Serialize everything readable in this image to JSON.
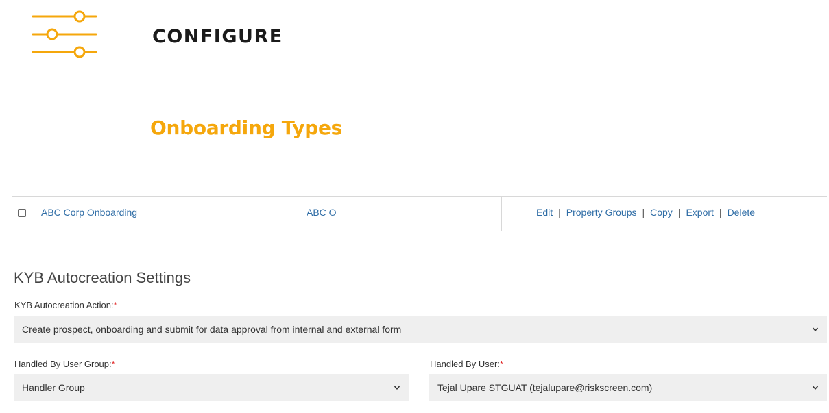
{
  "header": {
    "icon": "sliders-icon",
    "title": "CONFIGURE",
    "accent_color": "#f5a70c"
  },
  "page": {
    "heading": "Onboarding Types"
  },
  "table": {
    "rows": [
      {
        "name": "ABC Corp Onboarding",
        "code": "ABC O",
        "actions": {
          "edit": "Edit",
          "property_groups": "Property Groups",
          "copy": "Copy",
          "export": "Export",
          "delete": "Delete"
        },
        "separator": "|"
      }
    ]
  },
  "kyb": {
    "section_title": "KYB Autocreation Settings",
    "action_label": "KYB Autocreation Action:",
    "action_value": "Create prospect, onboarding and submit for data approval from internal and external form",
    "group_label": "Handled By User Group:",
    "group_value": "Handler Group",
    "user_label": "Handled By User:",
    "user_value": "Tejal Upare STGUAT (tejalupare@riskscreen.com)",
    "required_mark": "*"
  }
}
